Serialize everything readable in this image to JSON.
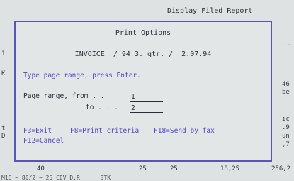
{
  "background": {
    "title": "Display Filed Report",
    "fragments": [
      {
        "id": "frag-left-1",
        "text": "1"
      },
      {
        "id": "frag-left-k",
        "text": "K"
      },
      {
        "id": "frag-left-t",
        "text": "t"
      },
      {
        "id": "frag-left-d",
        "text": "D"
      },
      {
        "id": "frag-right-dots",
        "text": ".."
      },
      {
        "id": "frag-right-46",
        "text": "46"
      },
      {
        "id": "frag-right-be",
        "text": "be"
      },
      {
        "id": "frag-right-ic",
        "text": "ic"
      },
      {
        "id": "frag-right-9",
        "text": ".9"
      },
      {
        "id": "frag-right-un",
        "text": "un"
      },
      {
        "id": "frag-right-7",
        "text": ",7"
      }
    ],
    "bottom_row": {
      "c1": "40",
      "c2": "25",
      "c3": "25",
      "c4": "18,25",
      "c5": "256,2"
    },
    "footer_fragment": "M16 ~ 80/2 ~ 25 CEV D.R      STK"
  },
  "dialog": {
    "title": "Print Options",
    "document_line": "INVOICE  / 94 3. qtr. /  2.07.94",
    "instruction": "Type page range, press Enter.",
    "from_label": "Page range, from . .",
    "to_label": "to . . .",
    "from_value": "1",
    "to_value": "2",
    "fkeys": {
      "exit": "F3=Exit",
      "print_criteria": "F8=Print criteria",
      "send_fax": "F18=Send by fax",
      "cancel": "F12=Cancel"
    }
  },
  "colors": {
    "accent": "#4f48c0",
    "border": "#5a54b8",
    "background": "#dfe2e3"
  }
}
